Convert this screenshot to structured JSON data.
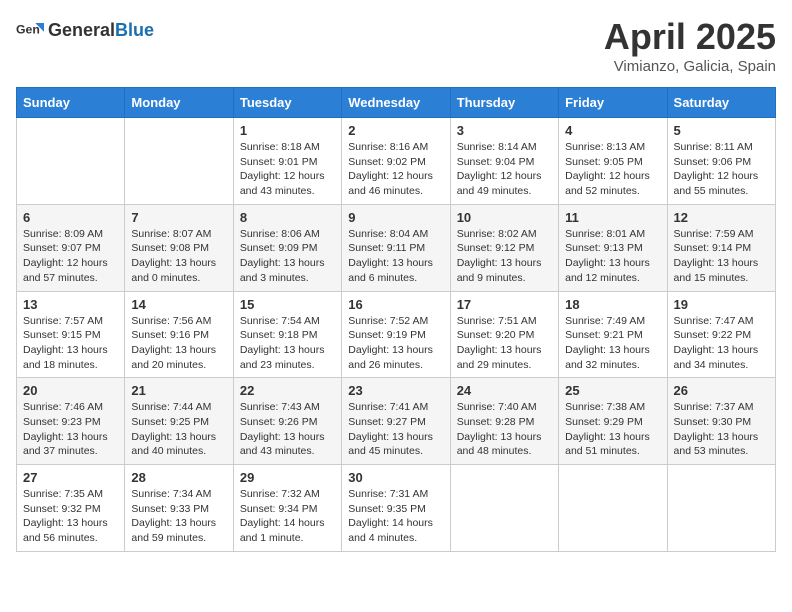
{
  "header": {
    "logo_general": "General",
    "logo_blue": "Blue",
    "title": "April 2025",
    "subtitle": "Vimianzo, Galicia, Spain"
  },
  "days_of_week": [
    "Sunday",
    "Monday",
    "Tuesday",
    "Wednesday",
    "Thursday",
    "Friday",
    "Saturday"
  ],
  "weeks": [
    [
      {
        "day": "",
        "sunrise": "",
        "sunset": "",
        "daylight": ""
      },
      {
        "day": "",
        "sunrise": "",
        "sunset": "",
        "daylight": ""
      },
      {
        "day": "1",
        "sunrise": "Sunrise: 8:18 AM",
        "sunset": "Sunset: 9:01 PM",
        "daylight": "Daylight: 12 hours and 43 minutes."
      },
      {
        "day": "2",
        "sunrise": "Sunrise: 8:16 AM",
        "sunset": "Sunset: 9:02 PM",
        "daylight": "Daylight: 12 hours and 46 minutes."
      },
      {
        "day": "3",
        "sunrise": "Sunrise: 8:14 AM",
        "sunset": "Sunset: 9:04 PM",
        "daylight": "Daylight: 12 hours and 49 minutes."
      },
      {
        "day": "4",
        "sunrise": "Sunrise: 8:13 AM",
        "sunset": "Sunset: 9:05 PM",
        "daylight": "Daylight: 12 hours and 52 minutes."
      },
      {
        "day": "5",
        "sunrise": "Sunrise: 8:11 AM",
        "sunset": "Sunset: 9:06 PM",
        "daylight": "Daylight: 12 hours and 55 minutes."
      }
    ],
    [
      {
        "day": "6",
        "sunrise": "Sunrise: 8:09 AM",
        "sunset": "Sunset: 9:07 PM",
        "daylight": "Daylight: 12 hours and 57 minutes."
      },
      {
        "day": "7",
        "sunrise": "Sunrise: 8:07 AM",
        "sunset": "Sunset: 9:08 PM",
        "daylight": "Daylight: 13 hours and 0 minutes."
      },
      {
        "day": "8",
        "sunrise": "Sunrise: 8:06 AM",
        "sunset": "Sunset: 9:09 PM",
        "daylight": "Daylight: 13 hours and 3 minutes."
      },
      {
        "day": "9",
        "sunrise": "Sunrise: 8:04 AM",
        "sunset": "Sunset: 9:11 PM",
        "daylight": "Daylight: 13 hours and 6 minutes."
      },
      {
        "day": "10",
        "sunrise": "Sunrise: 8:02 AM",
        "sunset": "Sunset: 9:12 PM",
        "daylight": "Daylight: 13 hours and 9 minutes."
      },
      {
        "day": "11",
        "sunrise": "Sunrise: 8:01 AM",
        "sunset": "Sunset: 9:13 PM",
        "daylight": "Daylight: 13 hours and 12 minutes."
      },
      {
        "day": "12",
        "sunrise": "Sunrise: 7:59 AM",
        "sunset": "Sunset: 9:14 PM",
        "daylight": "Daylight: 13 hours and 15 minutes."
      }
    ],
    [
      {
        "day": "13",
        "sunrise": "Sunrise: 7:57 AM",
        "sunset": "Sunset: 9:15 PM",
        "daylight": "Daylight: 13 hours and 18 minutes."
      },
      {
        "day": "14",
        "sunrise": "Sunrise: 7:56 AM",
        "sunset": "Sunset: 9:16 PM",
        "daylight": "Daylight: 13 hours and 20 minutes."
      },
      {
        "day": "15",
        "sunrise": "Sunrise: 7:54 AM",
        "sunset": "Sunset: 9:18 PM",
        "daylight": "Daylight: 13 hours and 23 minutes."
      },
      {
        "day": "16",
        "sunrise": "Sunrise: 7:52 AM",
        "sunset": "Sunset: 9:19 PM",
        "daylight": "Daylight: 13 hours and 26 minutes."
      },
      {
        "day": "17",
        "sunrise": "Sunrise: 7:51 AM",
        "sunset": "Sunset: 9:20 PM",
        "daylight": "Daylight: 13 hours and 29 minutes."
      },
      {
        "day": "18",
        "sunrise": "Sunrise: 7:49 AM",
        "sunset": "Sunset: 9:21 PM",
        "daylight": "Daylight: 13 hours and 32 minutes."
      },
      {
        "day": "19",
        "sunrise": "Sunrise: 7:47 AM",
        "sunset": "Sunset: 9:22 PM",
        "daylight": "Daylight: 13 hours and 34 minutes."
      }
    ],
    [
      {
        "day": "20",
        "sunrise": "Sunrise: 7:46 AM",
        "sunset": "Sunset: 9:23 PM",
        "daylight": "Daylight: 13 hours and 37 minutes."
      },
      {
        "day": "21",
        "sunrise": "Sunrise: 7:44 AM",
        "sunset": "Sunset: 9:25 PM",
        "daylight": "Daylight: 13 hours and 40 minutes."
      },
      {
        "day": "22",
        "sunrise": "Sunrise: 7:43 AM",
        "sunset": "Sunset: 9:26 PM",
        "daylight": "Daylight: 13 hours and 43 minutes."
      },
      {
        "day": "23",
        "sunrise": "Sunrise: 7:41 AM",
        "sunset": "Sunset: 9:27 PM",
        "daylight": "Daylight: 13 hours and 45 minutes."
      },
      {
        "day": "24",
        "sunrise": "Sunrise: 7:40 AM",
        "sunset": "Sunset: 9:28 PM",
        "daylight": "Daylight: 13 hours and 48 minutes."
      },
      {
        "day": "25",
        "sunrise": "Sunrise: 7:38 AM",
        "sunset": "Sunset: 9:29 PM",
        "daylight": "Daylight: 13 hours and 51 minutes."
      },
      {
        "day": "26",
        "sunrise": "Sunrise: 7:37 AM",
        "sunset": "Sunset: 9:30 PM",
        "daylight": "Daylight: 13 hours and 53 minutes."
      }
    ],
    [
      {
        "day": "27",
        "sunrise": "Sunrise: 7:35 AM",
        "sunset": "Sunset: 9:32 PM",
        "daylight": "Daylight: 13 hours and 56 minutes."
      },
      {
        "day": "28",
        "sunrise": "Sunrise: 7:34 AM",
        "sunset": "Sunset: 9:33 PM",
        "daylight": "Daylight: 13 hours and 59 minutes."
      },
      {
        "day": "29",
        "sunrise": "Sunrise: 7:32 AM",
        "sunset": "Sunset: 9:34 PM",
        "daylight": "Daylight: 14 hours and 1 minute."
      },
      {
        "day": "30",
        "sunrise": "Sunrise: 7:31 AM",
        "sunset": "Sunset: 9:35 PM",
        "daylight": "Daylight: 14 hours and 4 minutes."
      },
      {
        "day": "",
        "sunrise": "",
        "sunset": "",
        "daylight": ""
      },
      {
        "day": "",
        "sunrise": "",
        "sunset": "",
        "daylight": ""
      },
      {
        "day": "",
        "sunrise": "",
        "sunset": "",
        "daylight": ""
      }
    ]
  ]
}
